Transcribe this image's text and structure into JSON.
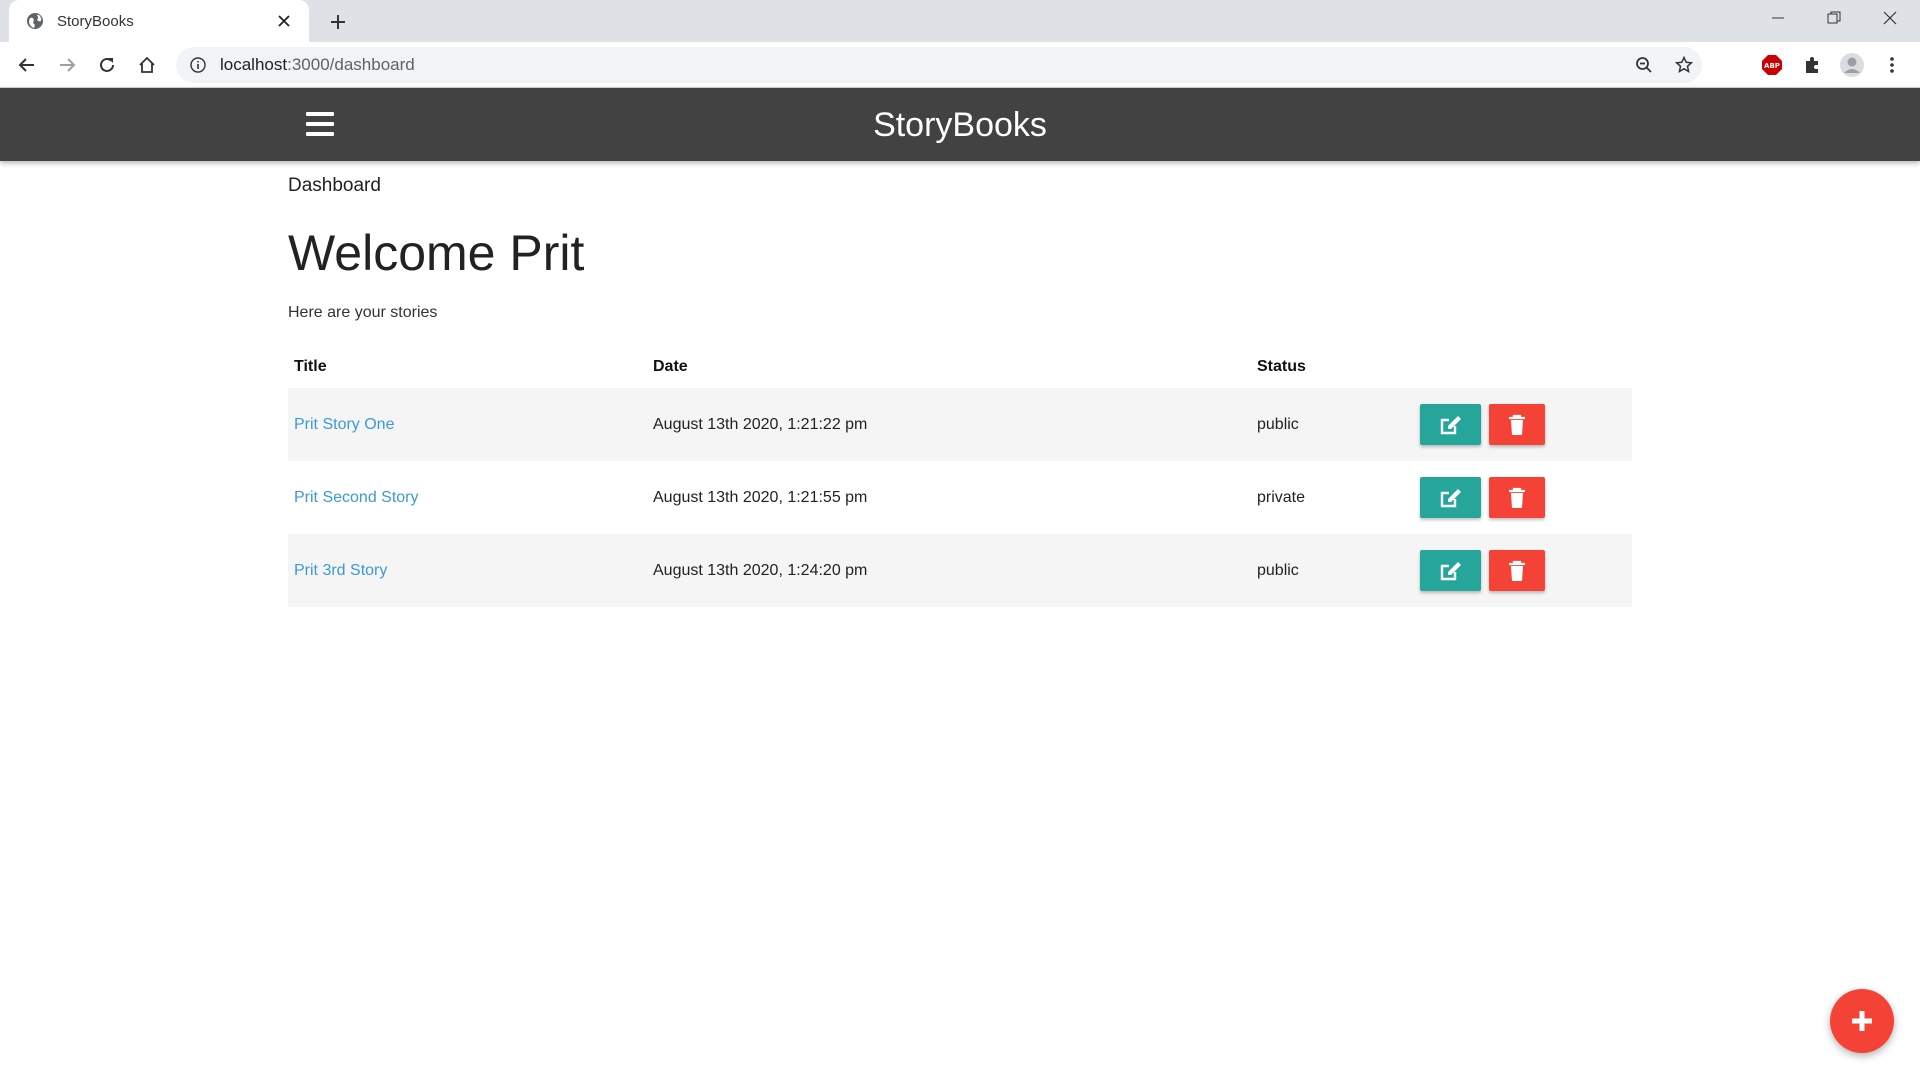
{
  "browser": {
    "tab_title": "StoryBooks",
    "url_host": "localhost",
    "url_path": ":3000/dashboard"
  },
  "nav": {
    "brand": "StoryBooks"
  },
  "page": {
    "breadcrumb": "Dashboard",
    "heading": "Welcome Prit",
    "subtitle": "Here are your stories"
  },
  "table": {
    "headers": [
      "Title",
      "Date",
      "Status"
    ],
    "rows": [
      {
        "title": "Prit Story One",
        "date": "August 13th 2020, 1:21:22 pm",
        "status": "public"
      },
      {
        "title": "Prit Second Story",
        "date": "August 13th 2020, 1:21:55 pm",
        "status": "private"
      },
      {
        "title": "Prit 3rd Story",
        "date": "August 13th 2020, 1:24:20 pm",
        "status": "public"
      }
    ]
  },
  "colors": {
    "navbar": "#424242",
    "link": "#3a9ad9",
    "edit": "#26a69a",
    "delete": "#f44336",
    "fab": "#f44336"
  },
  "icons": {
    "edit": "edit-icon",
    "delete": "trash-icon",
    "fab": "plus-icon",
    "menu": "hamburger-icon"
  }
}
